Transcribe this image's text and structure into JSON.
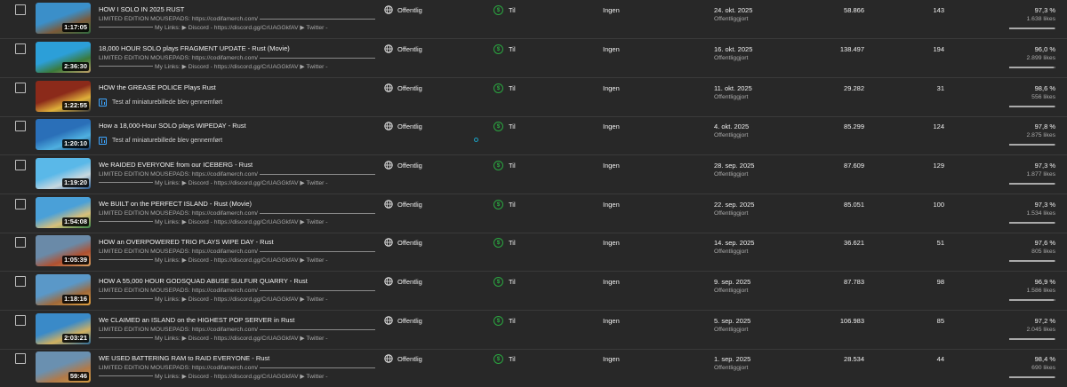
{
  "common": {
    "visibility_label": "Offentlig",
    "monetization_label": "Til",
    "restrictions_label": "Ingen",
    "date_status": "Offentliggjort",
    "desc_line1": "LIMITED EDITION MOUSEPADS: https://codifamerch.com/",
    "desc_line2": "My Links: ▶ Discord - https://discord.gg/CrUAGGkfAV ▶ Twitter -",
    "test_note": "Test af miniaturebillede blev gennemført",
    "colors": {
      "background": "#282828",
      "monetization_green": "#2ba640",
      "test_blue": "#3ea6ff",
      "like_bar_fill": "#aaaaaa",
      "like_bar_track": "#606060"
    },
    "icons": [
      "checkbox",
      "globe-icon",
      "dollar-circle-icon",
      "thumbnail-test-icon"
    ]
  },
  "videos": [
    {
      "title": "HOW I SOLO IN 2025 RUST",
      "duration": "1:17:05",
      "has_test": false,
      "date": "24. okt. 2025",
      "views": "58.866",
      "comments": "143",
      "likes_pct": "97,3 %",
      "likes_count": "1.638 likes",
      "like_ratio": 0.973
    },
    {
      "title": "18,000 HOUR SOLO plays FRAGMENT UPDATE - Rust (Movie)",
      "duration": "2:36:30",
      "has_test": false,
      "date": "16. okt. 2025",
      "views": "138.497",
      "comments": "194",
      "likes_pct": "96,0 %",
      "likes_count": "2.899 likes",
      "like_ratio": 0.96
    },
    {
      "title": "HOW the GREASE POLICE Plays Rust",
      "duration": "1:22:55",
      "has_test": true,
      "date": "11. okt. 2025",
      "views": "29.282",
      "comments": "31",
      "likes_pct": "98,6 %",
      "likes_count": "556 likes",
      "like_ratio": 0.986
    },
    {
      "title": "How a 18,000-Hour SOLO plays WIPEDAY - Rust",
      "duration": "1:20:10",
      "has_test": true,
      "date": "4. okt. 2025",
      "views": "85.299",
      "comments": "124",
      "likes_pct": "97,8 %",
      "likes_count": "2.875 likes",
      "like_ratio": 0.978
    },
    {
      "title": "We RAIDED EVERYONE from our ICEBERG - Rust",
      "duration": "1:19:20",
      "has_test": false,
      "date": "28. sep. 2025",
      "views": "87.609",
      "comments": "129",
      "likes_pct": "97,3 %",
      "likes_count": "1.877 likes",
      "like_ratio": 0.973
    },
    {
      "title": "We BUILT on the PERFECT ISLAND - Rust (Movie)",
      "duration": "1:54:08",
      "has_test": false,
      "date": "22. sep. 2025",
      "views": "85.051",
      "comments": "100",
      "likes_pct": "97,3 %",
      "likes_count": "1.534 likes",
      "like_ratio": 0.973
    },
    {
      "title": "HOW an OVERPOWERED TRIO PLAYS WIPE DAY - Rust",
      "duration": "1:05:39",
      "has_test": false,
      "date": "14. sep. 2025",
      "views": "36.621",
      "comments": "51",
      "likes_pct": "97,6 %",
      "likes_count": "805 likes",
      "like_ratio": 0.976
    },
    {
      "title": "HOW A 55,000 HOUR GODSQUAD ABUSE SULFUR QUARRY - Rust",
      "duration": "1:18:16",
      "has_test": false,
      "date": "9. sep. 2025",
      "views": "87.783",
      "comments": "98",
      "likes_pct": "96,9 %",
      "likes_count": "1.586 likes",
      "like_ratio": 0.969
    },
    {
      "title": "We CLAIMED an ISLAND on the HIGHEST POP SERVER in Rust",
      "duration": "2:03:21",
      "has_test": false,
      "date": "5. sep. 2025",
      "views": "106.983",
      "comments": "85",
      "likes_pct": "97,2 %",
      "likes_count": "2.045 likes",
      "like_ratio": 0.972
    },
    {
      "title": "WE USED BATTERING RAM to RAID EVERYONE - Rust",
      "duration": "59:46",
      "has_test": false,
      "date": "1. sep. 2025",
      "views": "28.534",
      "comments": "44",
      "likes_pct": "98,4 %",
      "likes_count": "690 likes",
      "like_ratio": 0.984
    }
  ]
}
